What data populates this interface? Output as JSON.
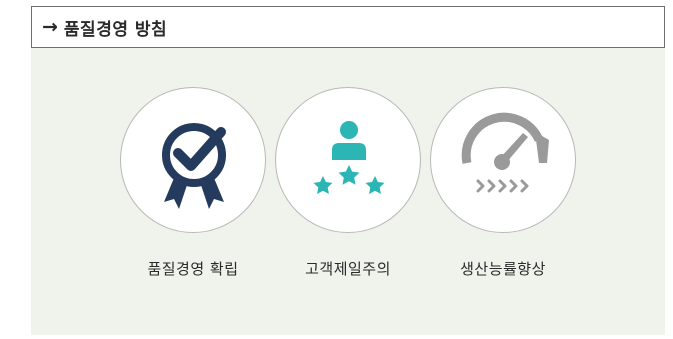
{
  "header": {
    "arrow": "→",
    "title": "품질경영 방침"
  },
  "items": [
    {
      "label": "품질경영 확립",
      "icon": "award-checkmark-icon",
      "color": "#243b5e"
    },
    {
      "label": "고객제일주의",
      "icon": "customer-rating-icon",
      "color": "#2bb5b5"
    },
    {
      "label": "생산능률향상",
      "icon": "speedometer-icon",
      "color": "#9a9a9a"
    }
  ]
}
